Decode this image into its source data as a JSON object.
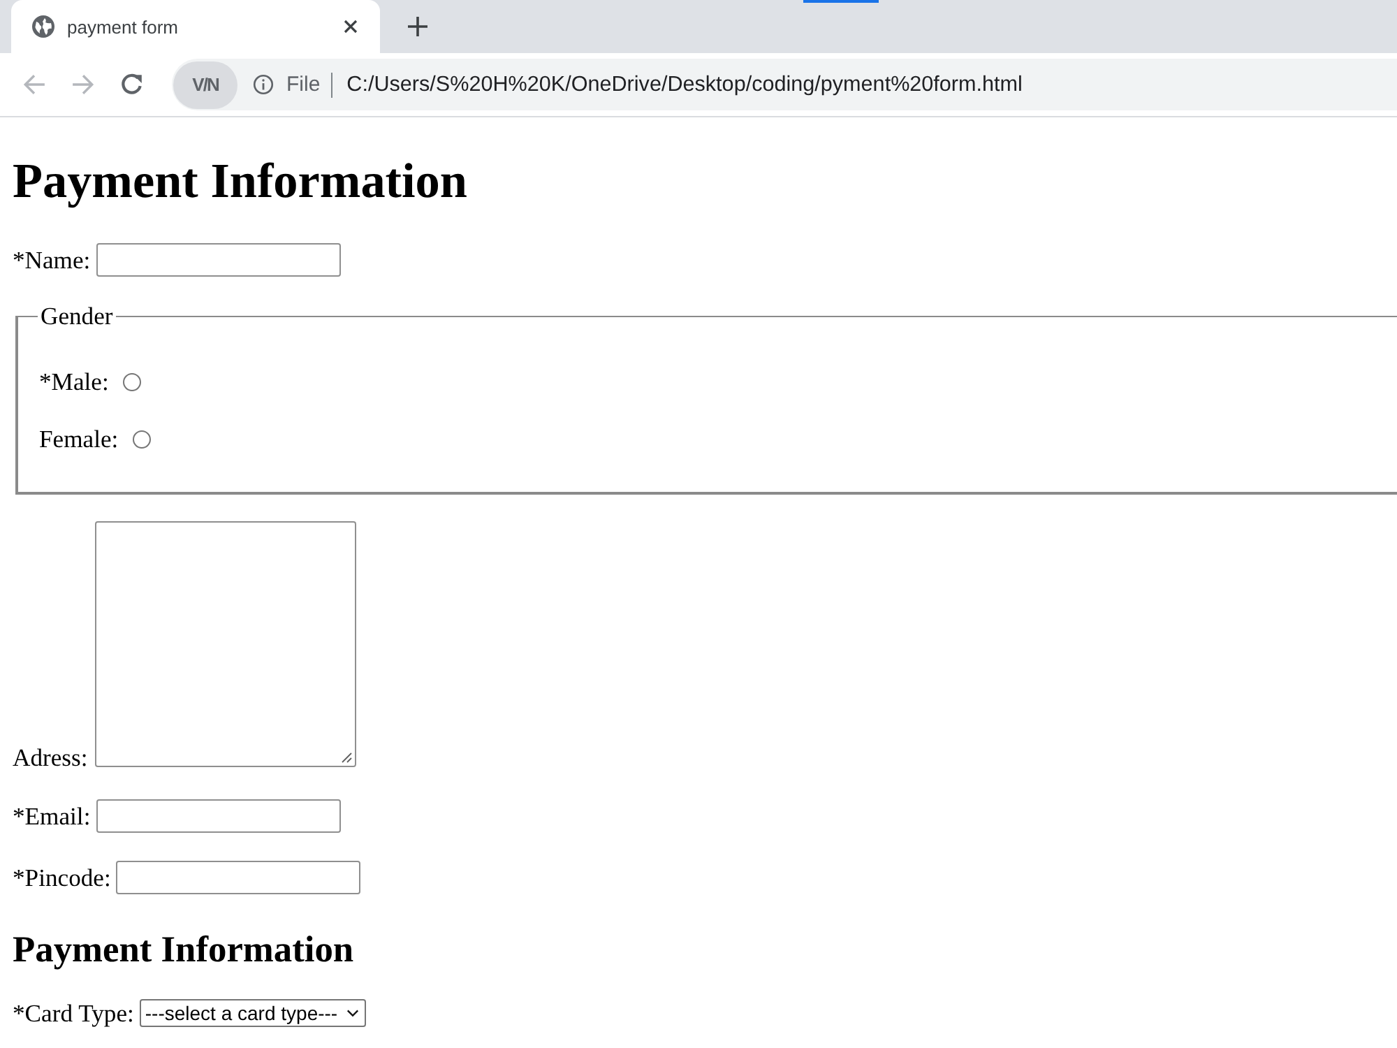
{
  "browser": {
    "tabs": [
      {
        "title": "payment form",
        "selected": true
      }
    ],
    "toolbar": {
      "nav_buttons": [
        {
          "kind": "back",
          "disabled": true
        },
        {
          "kind": "forward",
          "disabled": true
        },
        {
          "kind": "reload",
          "disabled": false
        }
      ],
      "extension_badge": "V/N",
      "address": {
        "scheme": "File",
        "url": "C:/Users/S%20H%20K/OneDrive/Desktop/coding/pyment%20form.html"
      }
    }
  },
  "page": {
    "title": "Payment Information",
    "fields": [
      {
        "kind": "text",
        "label": "*Name:"
      },
      {
        "kind": "radio_group",
        "legend": "Gender",
        "options": [
          {
            "label": "*Male:",
            "selected": false
          },
          {
            "label": "Female:",
            "selected": false
          }
        ]
      },
      {
        "kind": "textarea",
        "label": "Adress:"
      },
      {
        "kind": "text",
        "label": "*Email:"
      },
      {
        "kind": "text",
        "label": "*Pincode:"
      }
    ],
    "section_title": "Payment Information",
    "card_type": {
      "label": "*Card Type:",
      "value": "---select a card type---"
    }
  }
}
